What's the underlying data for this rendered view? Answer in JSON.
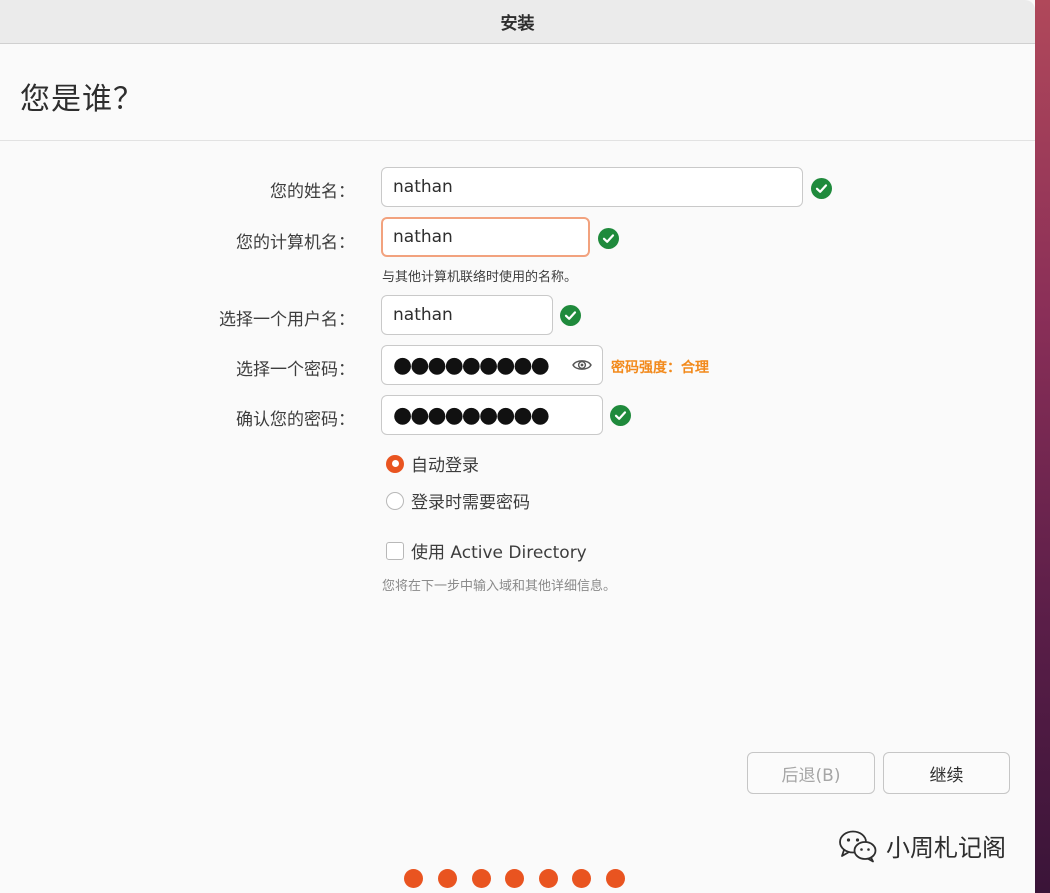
{
  "window": {
    "title": "安装"
  },
  "page": {
    "title": "您是谁？"
  },
  "form": {
    "name": {
      "label": "您的姓名：",
      "value": "nathan"
    },
    "computer": {
      "label": "您的计算机名：",
      "value": "nathan",
      "hint": "与其他计算机联络时使用的名称。"
    },
    "username": {
      "label": "选择一个用户名：",
      "value": "nathan"
    },
    "password": {
      "label": "选择一个密码：",
      "value": "●●●●●●●●●",
      "strength": "密码强度：合理"
    },
    "confirm": {
      "label": "确认您的密码：",
      "value": "●●●●●●●●●"
    }
  },
  "login_options": [
    {
      "label": "自动登录",
      "selected": true
    },
    {
      "label": "登录时需要密码",
      "selected": false
    }
  ],
  "active_directory": {
    "label": "使用 Active Directory",
    "checked": false,
    "hint": "您将在下一步中输入域和其他详细信息。"
  },
  "buttons": {
    "back": "后退(B)",
    "continue": "继续"
  },
  "watermark": {
    "text": "小周札记阁"
  },
  "progress": {
    "total": 7,
    "completed": 7
  },
  "colors": {
    "accent": "#e95420",
    "valid": "#1f8a3c",
    "strength": "#f28a1c",
    "focus_border": "#f2a27e"
  },
  "icons": {
    "valid": "check-circle-icon",
    "reveal": "eye-icon",
    "watermark": "wechat-icon"
  }
}
